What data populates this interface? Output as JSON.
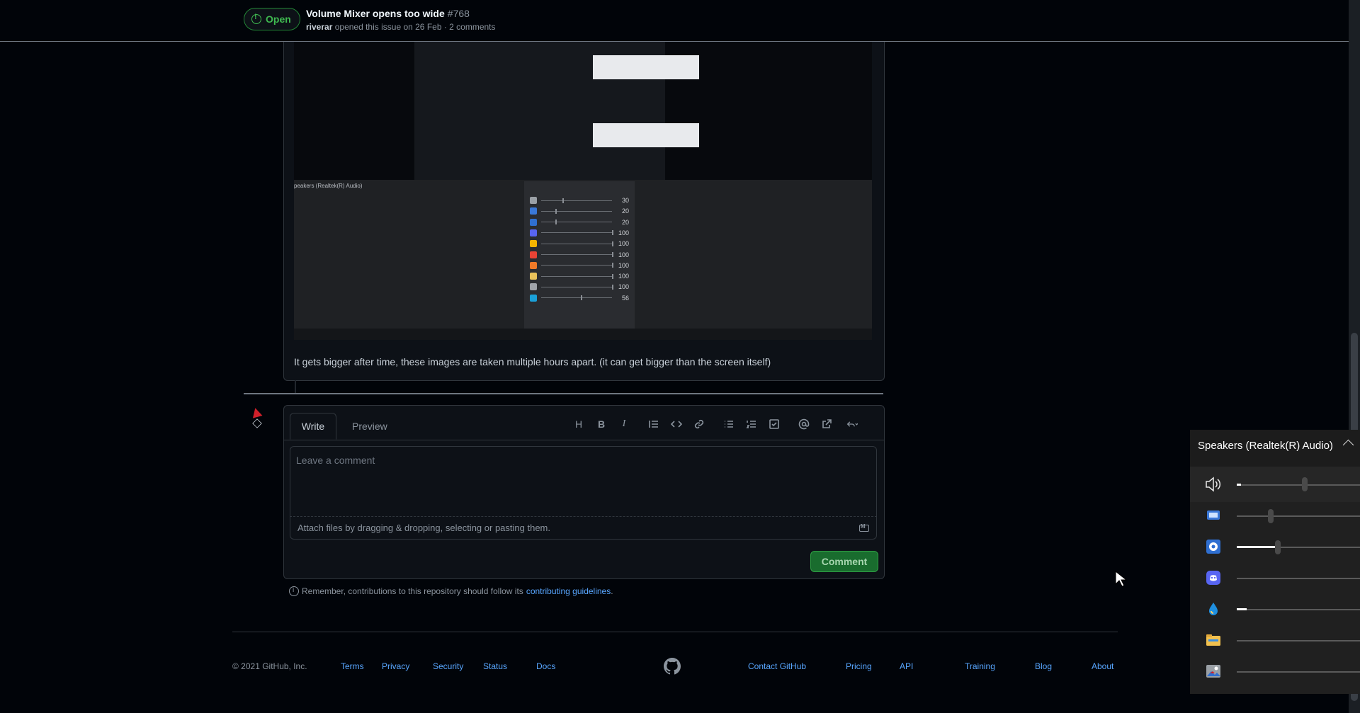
{
  "header": {
    "state": "Open",
    "title": "Volume Mixer opens too wide",
    "number": "#768",
    "author": "riverar",
    "meta": "opened this issue on 26 Feb · 2 comments"
  },
  "comment": {
    "screenshot_label": "peakers (Realtek(R) Audio)",
    "screenshot_rows": [
      {
        "value": "30",
        "level": 0.3,
        "color": "#9aa0a6"
      },
      {
        "value": "20",
        "level": 0.2,
        "color": "#3a78d8"
      },
      {
        "value": "20",
        "level": 0.2,
        "color": "#2f6fd1"
      },
      {
        "value": "100",
        "level": 1.0,
        "color": "#5865f2"
      },
      {
        "value": "100",
        "level": 1.0,
        "color": "#f5b400"
      },
      {
        "value": "100",
        "level": 1.0,
        "color": "#ea4335"
      },
      {
        "value": "100",
        "level": 1.0,
        "color": "#f07a28"
      },
      {
        "value": "100",
        "level": 1.0,
        "color": "#e8c15a"
      },
      {
        "value": "100",
        "level": 1.0,
        "color": "#a0a4aa"
      },
      {
        "value": "56",
        "level": 0.56,
        "color": "#1aa0d8"
      }
    ],
    "text": "It gets bigger after time, these images are taken multiple hours apart. (it can get bigger than the screen itself)"
  },
  "form": {
    "tab_write": "Write",
    "tab_preview": "Preview",
    "toolbar_heading": "H",
    "toolbar_bold": "B",
    "toolbar_italic": "I",
    "placeholder": "Leave a comment",
    "attach_text": "Attach files by dragging & dropping, selecting or pasting them.",
    "submit": "Comment",
    "remember_prefix": "Remember, contributions to this repository should follow its",
    "remember_link": "contributing guidelines",
    "remember_suffix": "."
  },
  "footer": {
    "copyright": "© 2021 GitHub, Inc.",
    "left_links": [
      "Terms",
      "Privacy",
      "Security",
      "Status",
      "Docs"
    ],
    "right_links": [
      "Contact GitHub",
      "Pricing",
      "API",
      "Training",
      "Blog",
      "About"
    ]
  },
  "mixer": {
    "title": "Speakers (Realtek(R) Audio)",
    "master_level": 0.02,
    "apps": [
      {
        "icon": "remote-desktop-icon",
        "level": 0.2,
        "color": "#3a78d8"
      },
      {
        "icon": "media-player-icon",
        "level": 0.2,
        "color": "#2f6fd1"
      },
      {
        "icon": "discord-icon",
        "level": 1.0,
        "color": "#5865f2"
      },
      {
        "icon": "water-drop-icon",
        "level": 1.0,
        "color": "#1f8fe0"
      },
      {
        "icon": "file-explorer-icon",
        "level": 1.0,
        "color": "#f2c14e"
      },
      {
        "icon": "photos-icon",
        "level": 1.0,
        "color": "#9aa0a6"
      }
    ]
  }
}
